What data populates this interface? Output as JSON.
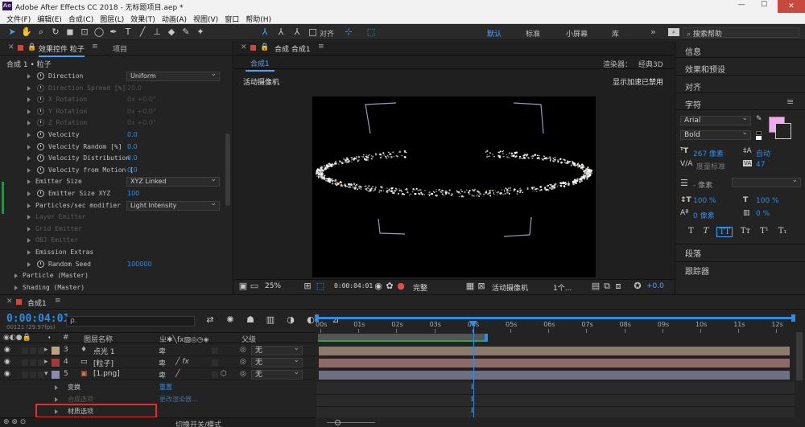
{
  "titlebar": {
    "app_icon": "Ae",
    "title": "Adobe After Effects CC 2018 - 无标题项目.aep *",
    "minimize": "—",
    "maximize": "☐",
    "close": "✕"
  },
  "menubar": [
    "文件(F)",
    "编辑(E)",
    "合成(C)",
    "图层(L)",
    "效果(T)",
    "动画(A)",
    "视图(V)",
    "窗口",
    "帮助(H)"
  ],
  "toolbar": {
    "align_label": "对齐",
    "workspaces": [
      "默认",
      "标准",
      "小屏幕",
      "库"
    ],
    "more": "»",
    "search_placeholder": "搜索帮助"
  },
  "effect_panel": {
    "tab_label": "效果控件 粒子",
    "project_tab": "项目",
    "breadcrumb": "合成 1 • 粒子",
    "rows": [
      {
        "label": "Direction",
        "value": "Uniform",
        "type": "dropdown",
        "stopwatch": true,
        "indent": 2,
        "dim": false
      },
      {
        "label": "Direction Spread [%]",
        "value": "20.0",
        "type": "value",
        "stopwatch": true,
        "indent": 2,
        "dim": true
      },
      {
        "label": "X Rotation",
        "value": "0x +0.0°",
        "type": "value",
        "stopwatch": true,
        "indent": 2,
        "dim": true
      },
      {
        "label": "Y Rotation",
        "value": "0x +0.0°",
        "type": "value",
        "stopwatch": true,
        "indent": 2,
        "dim": true
      },
      {
        "label": "Z Rotation",
        "value": "0x +0.0°",
        "type": "value",
        "stopwatch": true,
        "indent": 2,
        "dim": true
      },
      {
        "label": "Velocity",
        "value": "0.0",
        "type": "value",
        "stopwatch": true,
        "indent": 2,
        "dim": false
      },
      {
        "label": "Velocity Random [%]",
        "value": "0.0",
        "type": "value",
        "stopwatch": true,
        "indent": 2,
        "dim": false
      },
      {
        "label": "Velocity Distribution",
        "value": "0.0",
        "type": "value",
        "stopwatch": true,
        "indent": 2,
        "dim": false
      },
      {
        "label": "Velocity from Motion [",
        "value": "0.0",
        "type": "value",
        "stopwatch": true,
        "indent": 2,
        "dim": false
      },
      {
        "label": "Emitter Size",
        "value": "XYZ Linked",
        "type": "dropdown",
        "stopwatch": false,
        "indent": 2,
        "dim": false
      },
      {
        "label": "Emitter Size XYZ",
        "value": "100",
        "type": "value",
        "stopwatch": true,
        "indent": 2,
        "dim": false
      },
      {
        "label": "Particles/sec modifier",
        "value": "Light Intensity",
        "type": "dropdown",
        "stopwatch": false,
        "indent": 2,
        "dim": false
      },
      {
        "label": "Layer Emitter",
        "value": "",
        "type": "group",
        "stopwatch": false,
        "indent": 2,
        "dim": true
      },
      {
        "label": "Grid Emitter",
        "value": "",
        "type": "group",
        "stopwatch": false,
        "indent": 2,
        "dim": true
      },
      {
        "label": "OBJ Emitter",
        "value": "",
        "type": "group",
        "stopwatch": false,
        "indent": 2,
        "dim": true
      },
      {
        "label": "Emission Extras",
        "value": "",
        "type": "group",
        "stopwatch": false,
        "indent": 2,
        "dim": false
      },
      {
        "label": "Random Seed",
        "value": "100000",
        "type": "value",
        "stopwatch": true,
        "indent": 2,
        "dim": false
      },
      {
        "label": "Particle (Master)",
        "value": "",
        "type": "group",
        "stopwatch": false,
        "indent": 1,
        "dim": false
      },
      {
        "label": "Shading (Master)",
        "value": "",
        "type": "group",
        "stopwatch": false,
        "indent": 1,
        "dim": false
      }
    ]
  },
  "comp_panel": {
    "tab_label": "合成 合成1",
    "sub_tab": "合成1",
    "renderer_label": "渲染器：",
    "renderer_value": "经典3D",
    "camera_label": "活动摄像机",
    "gpu_label": "显示加速已禁用",
    "bottom": {
      "zoom": "25%",
      "timecode": "0:00:04:01",
      "resolution": "完整",
      "view": "活动摄像机",
      "views_count": "1个...",
      "exposure": "+0.0"
    }
  },
  "right_panel": {
    "items_top": [
      "信息",
      "效果和预设",
      "对齐"
    ],
    "char_title": "字符",
    "font": "Arial",
    "style": "Bold",
    "font_size": "267 像素",
    "leading": "自动",
    "kerning": "度量标准",
    "tracking": "47",
    "stroke_width": "- 像素",
    "vscale": "100 %",
    "hscale": "100 %",
    "baseline": "0 像素",
    "tsume": "0 %",
    "fill_color": "#f0aaf0",
    "text_style_buttons": [
      "T",
      "T",
      "TT",
      "Tт",
      "T¹",
      "T₁"
    ],
    "items_bottom": [
      "段落",
      "跟踪器"
    ]
  },
  "timeline": {
    "tab_label": "合成1",
    "timecode": "0:00:04:01",
    "frame_info": "00121 (29.97fps)",
    "search_placeholder": "ρ.",
    "columns": {
      "num": "#",
      "name": "图层名称",
      "parent": "父级"
    },
    "layers": [
      {
        "num": "3",
        "name": "点光 1",
        "color": "#bfa282",
        "parent": "无",
        "bar_color": "#8e7a6a"
      },
      {
        "num": "4",
        "name": "[粒子]",
        "color": "#a13a3a",
        "parent": "无",
        "bar_color": "#8e6a6a"
      },
      {
        "num": "5",
        "name": "[1.png]",
        "color": "#8a8ab0",
        "parent": "无",
        "bar_color": "#6e6e84"
      }
    ],
    "sub_rows": [
      {
        "label": "变换",
        "value": "重置"
      },
      {
        "label": "合成选项",
        "value": "更改渲染器..."
      },
      {
        "label": "材质选项",
        "value": ""
      }
    ],
    "ruler": [
      "00s",
      "01s",
      "02s",
      "03s",
      "04s",
      "05s",
      "06s",
      "07s",
      "08s",
      "09s",
      "10s",
      "11s",
      "12s"
    ],
    "footer_label": "切换开关/模式"
  }
}
